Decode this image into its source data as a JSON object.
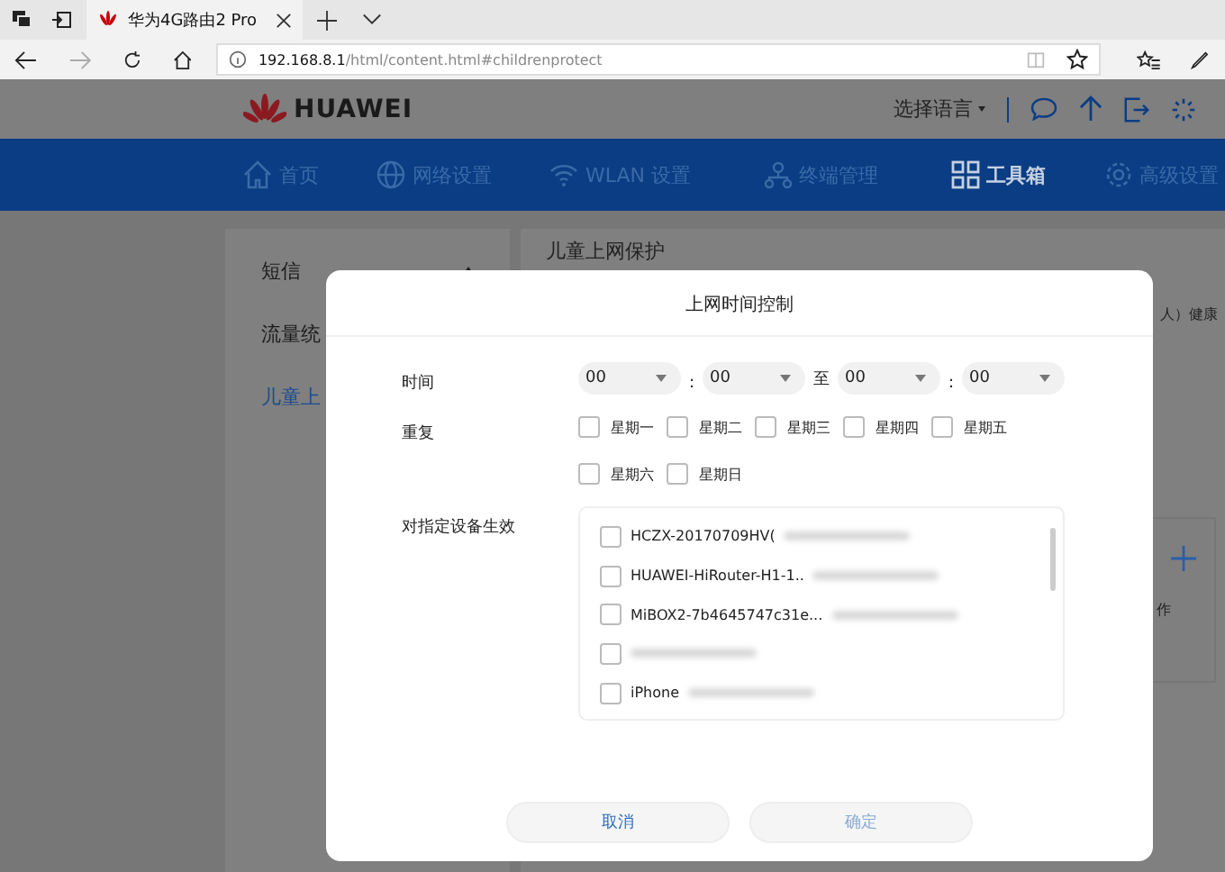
{
  "browser": {
    "tab_title": "华为4G路由2 Pro",
    "address_host": "192.168.8.1",
    "address_path": "/html/content.html#childrenprotect"
  },
  "header": {
    "logo": "HUAWEI",
    "language": "选择语言"
  },
  "nav": [
    {
      "label": "首页",
      "selected": false
    },
    {
      "label": "网络设置",
      "selected": false
    },
    {
      "label": "WLAN 设置",
      "selected": false
    },
    {
      "label": "终端管理",
      "selected": false
    },
    {
      "label": "工具箱",
      "selected": true
    },
    {
      "label": "高级设置",
      "selected": false
    }
  ],
  "sidebar": [
    {
      "label": "短信",
      "selected": false
    },
    {
      "label": "流量统",
      "selected": false
    },
    {
      "label": "儿童上",
      "selected": true
    }
  ],
  "main": {
    "title": "儿童上网保护",
    "text_right": "人）健康",
    "column_text": "作"
  },
  "dialog": {
    "title": "上网时间控制",
    "time_label": "时间",
    "times": [
      "00",
      "00",
      "00",
      "00"
    ],
    "colon": ":",
    "to": "至",
    "repeat_label": "重复",
    "days": [
      {
        "label": "星期一",
        "checked": false
      },
      {
        "label": "星期二",
        "checked": false
      },
      {
        "label": "星期三",
        "checked": false
      },
      {
        "label": "星期四",
        "checked": false
      },
      {
        "label": "星期五",
        "checked": false
      },
      {
        "label": "星期六",
        "checked": false
      },
      {
        "label": "星期日",
        "checked": false
      }
    ],
    "devices_label": "对指定设备生效",
    "devices": [
      {
        "name": "HCZX-20170709HV(",
        "checked": false,
        "redacted": true
      },
      {
        "name": "HUAWEI-HiRouter-H1-1..",
        "checked": false,
        "redacted": true
      },
      {
        "name": "MiBOX2-7b4645747c31e...",
        "checked": false,
        "redacted": true
      },
      {
        "checked": false,
        "redacted": true
      },
      {
        "name": "iPhone",
        "checked": false,
        "redacted": true
      }
    ],
    "buttons": [
      {
        "label": "取消",
        "disabled": false
      },
      {
        "label": "确定",
        "disabled": true
      }
    ]
  }
}
